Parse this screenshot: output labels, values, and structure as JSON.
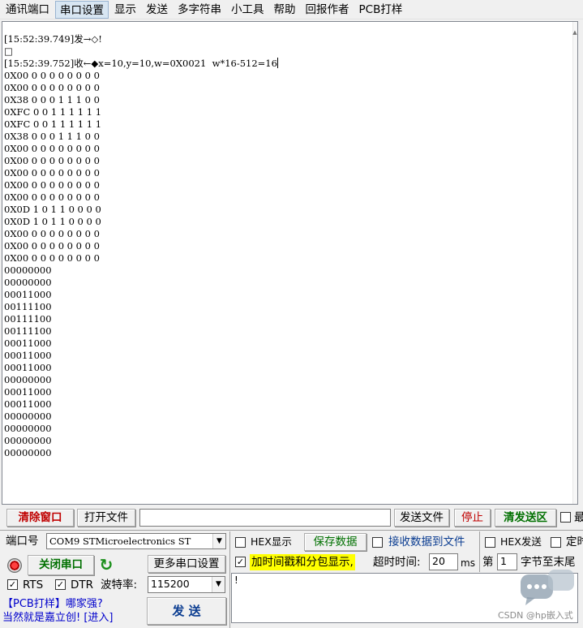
{
  "menu": [
    "通讯端口",
    "串口设置",
    "显示",
    "发送",
    "多字符串",
    "小工具",
    "帮助",
    "回报作者",
    "PCB打样"
  ],
  "log": {
    "lines": [
      "[15:52:39.749]发→◇!",
      "□",
      "[15:52:39.752]收←◆x=10,y=10,w=0X0021  w*16-512=16",
      "0X00 0 0 0 0 0 0 0 0",
      "0X00 0 0 0 0 0 0 0 0",
      "0X38 0 0 0 1 1 1 0 0",
      "0XFC 0 0 1 1 1 1 1 1",
      "0XFC 0 0 1 1 1 1 1 1",
      "0X38 0 0 0 1 1 1 0 0",
      "0X00 0 0 0 0 0 0 0 0",
      "0X00 0 0 0 0 0 0 0 0",
      "0X00 0 0 0 0 0 0 0 0",
      "0X00 0 0 0 0 0 0 0 0",
      "0X00 0 0 0 0 0 0 0 0",
      "0X0D 1 0 1 1 0 0 0 0",
      "0X0D 1 0 1 1 0 0 0 0",
      "0X00 0 0 0 0 0 0 0 0",
      "0X00 0 0 0 0 0 0 0 0",
      "0X00 0 0 0 0 0 0 0 0",
      "00000000",
      "00000000",
      "00011000",
      "00111100",
      "00111100",
      "00111100",
      "00011000",
      "00011000",
      "00011000",
      "00000000",
      "00011000",
      "00011000",
      "00000000",
      "00000000",
      "00000000",
      "00000000"
    ]
  },
  "toolbar1": {
    "clear_window": "清除窗口",
    "open_file": "打开文件",
    "send_file": "发送文件",
    "stop": "停止",
    "clear_send": "清发送区",
    "last_cut": "最"
  },
  "port": {
    "label": "端口号",
    "value": "COM9 STMicroelectronics ST",
    "close_port": "关闭串口",
    "more_settings": "更多串口设置",
    "rts": "RTS",
    "dtr": "DTR",
    "baud_label": "波特率:",
    "baud_value": "115200"
  },
  "display_opts": {
    "hex_display": "HEX显示",
    "save_data": "保存数据",
    "recv_to_file": "接收数据到文件",
    "timestamp": "加时间戳和分包显示,",
    "timeout_label": "超时时间:",
    "timeout_value": "20",
    "timeout_unit": "ms"
  },
  "send_opts": {
    "hex_send": "HEX发送",
    "timed": "定时",
    "index_label": "第",
    "index_value": "1",
    "byte_end": "字节至末尾"
  },
  "send_box": {
    "content": "!"
  },
  "send_button": "发  送",
  "promo": {
    "line1": "【PCB打样】哪家强?",
    "line2": "当然就是嘉立创! [进入]"
  },
  "watermark": "CSDN @hp嵌入式"
}
